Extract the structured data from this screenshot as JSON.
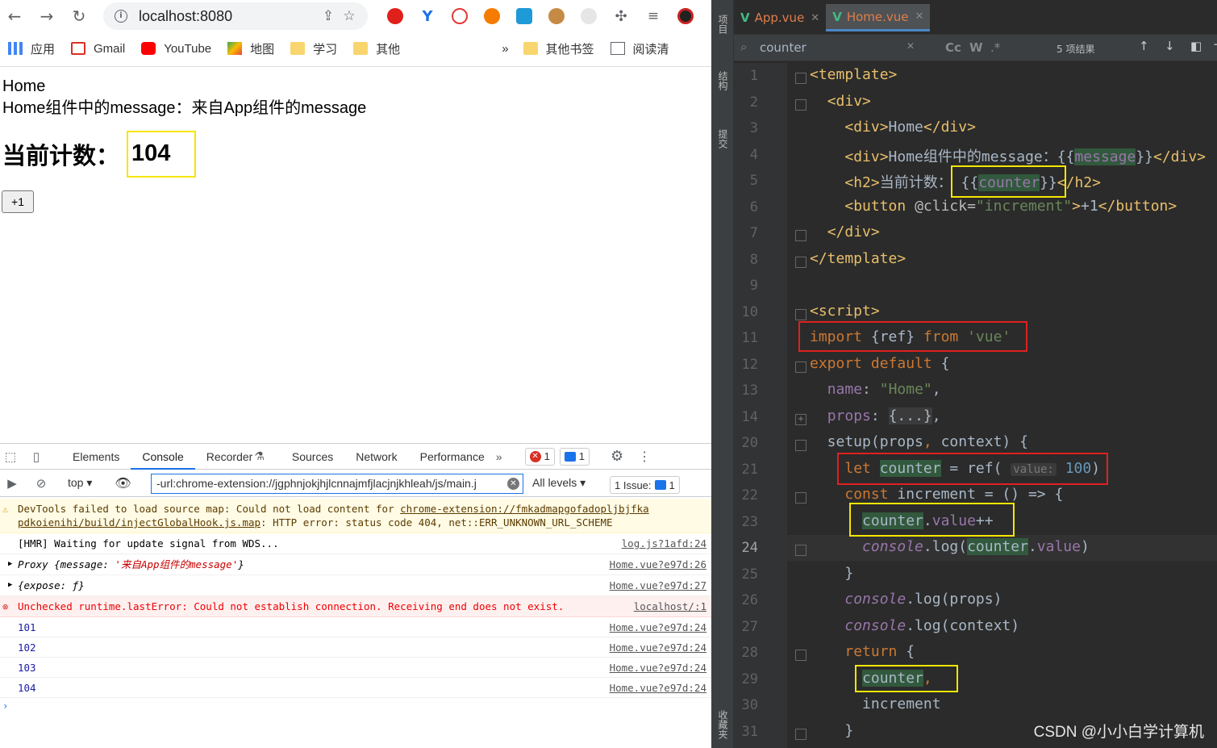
{
  "browser": {
    "url": "localhost:8080",
    "bookmarks": [
      "应用",
      "Gmail",
      "YouTube",
      "地图",
      "学习",
      "其他",
      "其他书签",
      "阅读清"
    ]
  },
  "page": {
    "line1": "Home",
    "line2": "Home组件中的message：来自App组件的message",
    "h2_label": "当前计数：",
    "counter": "104",
    "button": "+1"
  },
  "devtools": {
    "tabs": [
      "Elements",
      "Console",
      "Recorder",
      "Sources",
      "Network",
      "Performance"
    ],
    "error_count": "1",
    "message_count": "1",
    "context": "top",
    "filter": "-url:chrome-extension://jgphnjokjhjlcnnajmfjlacjnjkhleah/js/main.j",
    "levels": "All levels",
    "issues": "1 Issue:",
    "issues_count": "1",
    "logs": [
      {
        "kind": "warn",
        "text_a": "DevTools failed to load source map: Could not load content for ",
        "link": "chrome-extension://fmkadmapgofadopljbjfka",
        "text_b": "pdkoienihi/build/injectGlobalHook.js.map",
        "text_c": ": HTTP error: status code 404, net::ERR_UNKNOWN_URL_SCHEME"
      },
      {
        "kind": "log",
        "text": "[HMR] Waiting for update signal from WDS...",
        "src": "log.js?1afd:24"
      },
      {
        "kind": "obj",
        "text_a": "Proxy {message: ",
        "text_b": "'来自App组件的message'",
        "text_c": "}",
        "src": "Home.vue?e97d:26"
      },
      {
        "kind": "obj2",
        "text": "{expose: ƒ}",
        "src": "Home.vue?e97d:27"
      },
      {
        "kind": "err",
        "text": "Unchecked runtime.lastError: Could not establish connection. Receiving end does not exist.",
        "src": "localhost/:1"
      },
      {
        "kind": "num",
        "text": "101",
        "src": "Home.vue?e97d:24"
      },
      {
        "kind": "num",
        "text": "102",
        "src": "Home.vue?e97d:24"
      },
      {
        "kind": "num",
        "text": "103",
        "src": "Home.vue?e97d:24"
      },
      {
        "kind": "num",
        "text": "104",
        "src": "Home.vue?e97d:24"
      }
    ]
  },
  "ide": {
    "tabs": [
      "App.vue",
      "Home.vue"
    ],
    "search": "counter",
    "results": "5 项结果",
    "side_labels": [
      "项目",
      "结构",
      "提交",
      "收藏夹"
    ],
    "line_numbers": [
      "1",
      "2",
      "3",
      "4",
      "5",
      "6",
      "7",
      "8",
      "9",
      "10",
      "11",
      "12",
      "13",
      "14",
      "20",
      "21",
      "22",
      "23",
      "24",
      "25",
      "26",
      "27",
      "28",
      "29",
      "30",
      "31"
    ],
    "watermark": "CSDN @小小白学计算机"
  },
  "colors": {
    "highlight_yellow": "#f5e600",
    "highlight_red": "#e02020",
    "vue_green": "#42b883"
  }
}
